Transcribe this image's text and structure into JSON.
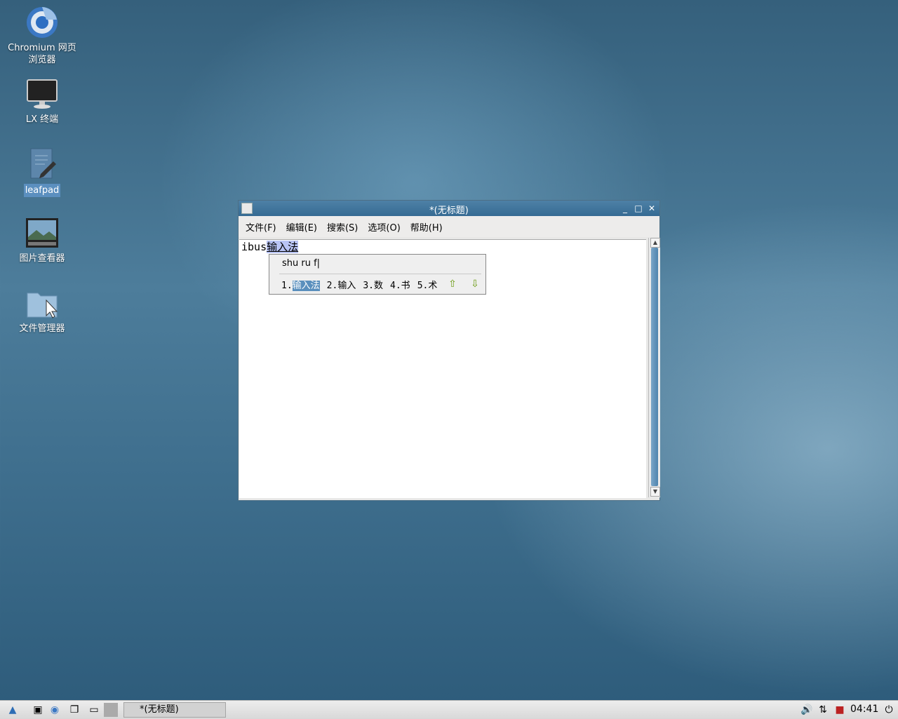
{
  "desktop": {
    "icons": [
      {
        "label_line1": "Chromium 网页",
        "label_line2": "浏览器"
      },
      {
        "label_line1": "LX 终端",
        "label_line2": ""
      },
      {
        "label_line1": "leafpad",
        "label_line2": ""
      },
      {
        "label_line1": "图片查看器",
        "label_line2": ""
      },
      {
        "label_line1": "文件管理器",
        "label_line2": ""
      }
    ]
  },
  "window": {
    "title": "*(无标题)",
    "buttons": {
      "minimize": "_",
      "maximize": "□",
      "close": "✕"
    },
    "menu": [
      "文件(F)",
      "编辑(E)",
      "搜索(S)",
      "选项(O)",
      "帮助(H)"
    ],
    "editor": {
      "text": "ibus",
      "preedit": "输入法"
    }
  },
  "ime": {
    "pinyin": "shu ru f|",
    "candidates": [
      {
        "index": "1.",
        "word": "输入法"
      },
      {
        "index": "2.",
        "word": "输入"
      },
      {
        "index": "3.",
        "word": "数"
      },
      {
        "index": "4.",
        "word": "书"
      },
      {
        "index": "5.",
        "word": "术"
      }
    ],
    "selected_index": 0,
    "prev_icon": "arrow-up-icon",
    "next_icon": "arrow-down-icon"
  },
  "taskbar": {
    "task_label": "*(无标题)",
    "clock": "04:41"
  }
}
